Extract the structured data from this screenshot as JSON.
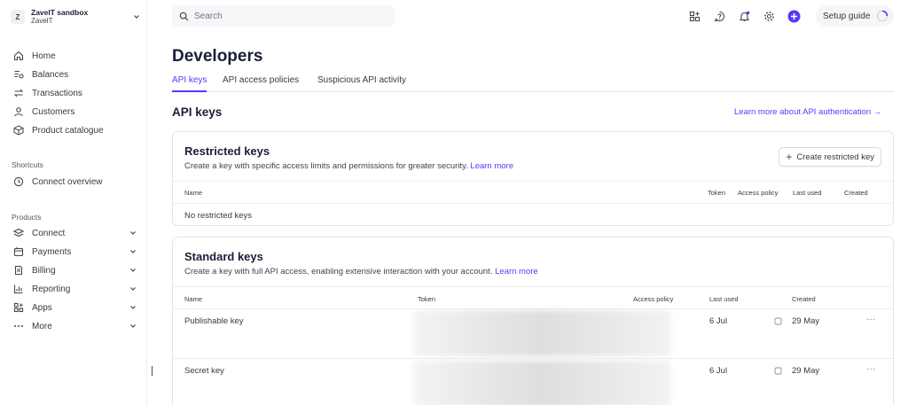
{
  "account": {
    "avatar": "Z",
    "name": "ZavelT sandbox",
    "sub": "ZavelT"
  },
  "sidebar": {
    "main": [
      {
        "label": "Home",
        "icon": "home-icon"
      },
      {
        "label": "Balances",
        "icon": "balances-icon"
      },
      {
        "label": "Transactions",
        "icon": "transactions-icon"
      },
      {
        "label": "Customers",
        "icon": "customers-icon"
      },
      {
        "label": "Product catalogue",
        "icon": "product-icon"
      }
    ],
    "shortcuts_label": "Shortcuts",
    "shortcuts": [
      {
        "label": "Connect overview",
        "icon": "clock-icon"
      }
    ],
    "products_label": "Products",
    "products": [
      {
        "label": "Connect",
        "icon": "connect-icon"
      },
      {
        "label": "Payments",
        "icon": "payments-icon"
      },
      {
        "label": "Billing",
        "icon": "billing-icon"
      },
      {
        "label": "Reporting",
        "icon": "reporting-icon"
      },
      {
        "label": "Apps",
        "icon": "apps-icon"
      },
      {
        "label": "More",
        "icon": "more-icon"
      }
    ]
  },
  "topbar": {
    "search_placeholder": "Search",
    "setup_label": "Setup guide",
    "accent": "#533afd"
  },
  "page": {
    "title": "Developers",
    "tabs": [
      "API keys",
      "API access policies",
      "Suspicious API activity"
    ],
    "section_title": "API keys",
    "learn_more": "Learn more about API authentication →"
  },
  "restricted": {
    "title": "Restricted keys",
    "desc": "Create a key with specific access limits and permissions for greater security.",
    "learn": "Learn more",
    "create_button": "Create restricted key",
    "headers": {
      "name": "Name",
      "token": "Token",
      "policy": "Access policy",
      "last_used": "Last used",
      "created": "Created"
    },
    "empty": "No restricted keys"
  },
  "standard": {
    "title": "Standard keys",
    "desc": "Create a key with full API access, enabling extensive interaction with your account.",
    "learn": "Learn more",
    "headers": {
      "name": "Name",
      "token": "Token",
      "policy": "Access policy",
      "last_used": "Last used",
      "created": "Created"
    },
    "rows": [
      {
        "name": "Publishable key",
        "last_used": "6 Jul",
        "created": "29 May",
        "more": "···"
      },
      {
        "name": "Secret key",
        "last_used": "6 Jul",
        "created": "29 May",
        "more": "···"
      }
    ]
  }
}
